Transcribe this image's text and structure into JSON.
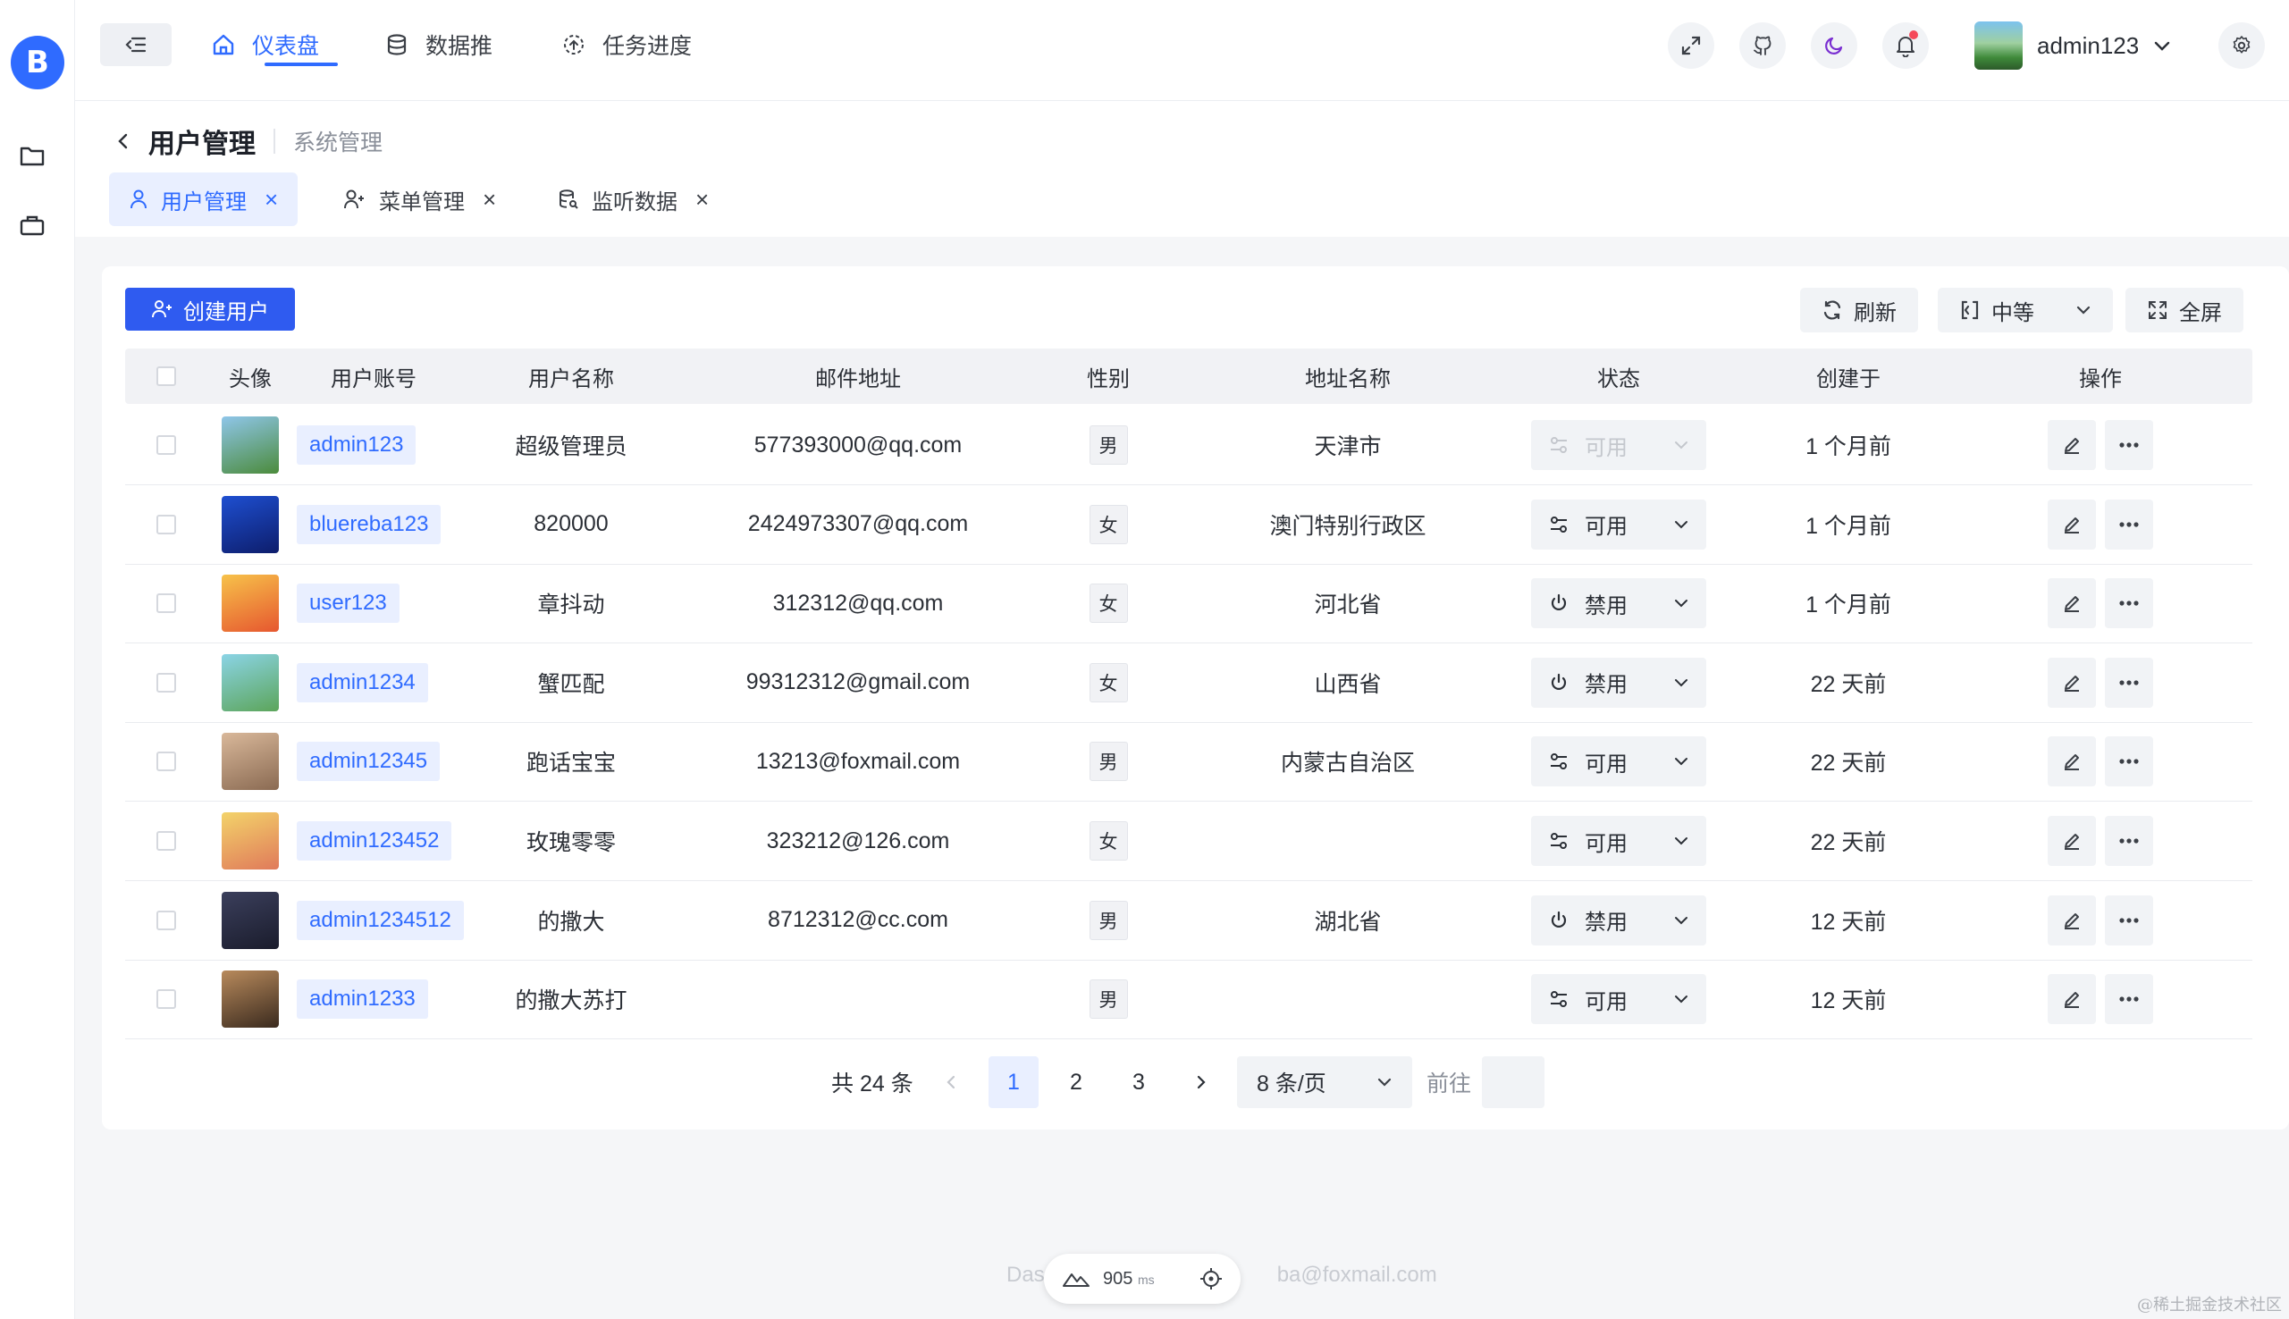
{
  "app": {
    "logo": "B"
  },
  "header": {
    "nav": [
      {
        "label": "仪表盘",
        "icon": "home-icon",
        "active": true
      },
      {
        "label": "数据推",
        "icon": "database-icon",
        "active": false
      },
      {
        "label": "任务进度",
        "icon": "progress-icon",
        "active": false
      }
    ],
    "user": {
      "name": "admin123"
    }
  },
  "breadcrumb": {
    "title": "用户管理",
    "parent": "系统管理"
  },
  "tabs": [
    {
      "label": "用户管理",
      "icon": "user-icon",
      "active": true
    },
    {
      "label": "菜单管理",
      "icon": "user-add-icon",
      "active": false
    },
    {
      "label": "监听数据",
      "icon": "database-search-icon",
      "active": false
    }
  ],
  "toolbar": {
    "create": "创建用户",
    "refresh": "刷新",
    "density": "中等",
    "fullscreen": "全屏"
  },
  "table": {
    "columns": [
      "头像",
      "用户账号",
      "用户名称",
      "邮件地址",
      "性别",
      "地址名称",
      "状态",
      "创建于",
      "操作"
    ],
    "rows": [
      {
        "account": "admin123",
        "name": "超级管理员",
        "email": "577393000@qq.com",
        "gender": "男",
        "address": "天津市",
        "status": "可用",
        "status_type": "enabled",
        "disabled_control": true,
        "created": "1 个月前",
        "avatar_colors": [
          "#8fc6ea",
          "#4b8b3b"
        ]
      },
      {
        "account": "bluereba123",
        "name": "820000",
        "email": "2424973307@qq.com",
        "gender": "女",
        "address": "澳门特别行政区",
        "status": "可用",
        "status_type": "enabled",
        "disabled_control": false,
        "created": "1 个月前",
        "avatar_colors": [
          "#1e4fd1",
          "#0d1d6b"
        ]
      },
      {
        "account": "user123",
        "name": "章抖动",
        "email": "312312@qq.com",
        "gender": "女",
        "address": "河北省",
        "status": "禁用",
        "status_type": "disabled",
        "disabled_control": false,
        "created": "1 个月前",
        "avatar_colors": [
          "#f7c24a",
          "#e6572f"
        ]
      },
      {
        "account": "admin1234",
        "name": "蟹匹配",
        "email": "99312312@gmail.com",
        "gender": "女",
        "address": "山西省",
        "status": "禁用",
        "status_type": "disabled",
        "disabled_control": false,
        "created": "22 天前",
        "avatar_colors": [
          "#8bd4e6",
          "#5ca55a"
        ]
      },
      {
        "account": "admin12345",
        "name": "跑话宝宝",
        "email": "13213@foxmail.com",
        "gender": "男",
        "address": "内蒙古自治区",
        "status": "可用",
        "status_type": "enabled",
        "disabled_control": false,
        "created": "22 天前",
        "avatar_colors": [
          "#d9b89a",
          "#8a6a52"
        ]
      },
      {
        "account": "admin123452",
        "name": "玫瑰零零",
        "email": "323212@126.com",
        "gender": "女",
        "address": "",
        "status": "可用",
        "status_type": "enabled",
        "disabled_control": false,
        "created": "22 天前",
        "avatar_colors": [
          "#f3d36a",
          "#e07a5a"
        ]
      },
      {
        "account": "admin1234512",
        "name": "的撒大",
        "email": "8712312@cc.com",
        "gender": "男",
        "address": "湖北省",
        "status": "禁用",
        "status_type": "disabled",
        "disabled_control": false,
        "created": "12 天前",
        "avatar_colors": [
          "#3b3f5c",
          "#1a1c2c"
        ]
      },
      {
        "account": "admin1233",
        "name": "的撒大苏打",
        "email": "",
        "gender": "男",
        "address": "",
        "status": "可用",
        "status_type": "enabled",
        "disabled_control": false,
        "created": "12 天前",
        "avatar_colors": [
          "#b88a5c",
          "#3a2a1e"
        ]
      }
    ]
  },
  "pagination": {
    "total": "共 24 条",
    "pages": [
      "1",
      "2",
      "3"
    ],
    "current": "1",
    "page_size": "8 条/页",
    "goto_label": "前往",
    "goto_value": ""
  },
  "footer": {
    "left": "Das",
    "right": "ba@foxmail.com",
    "perf_value": "905",
    "perf_unit": "ms"
  },
  "watermark": "@稀土掘金技术社区",
  "colors": {
    "primary": "#2f6bff",
    "create_button": "#2f5bf0",
    "danger_dot": "#f5495a"
  }
}
